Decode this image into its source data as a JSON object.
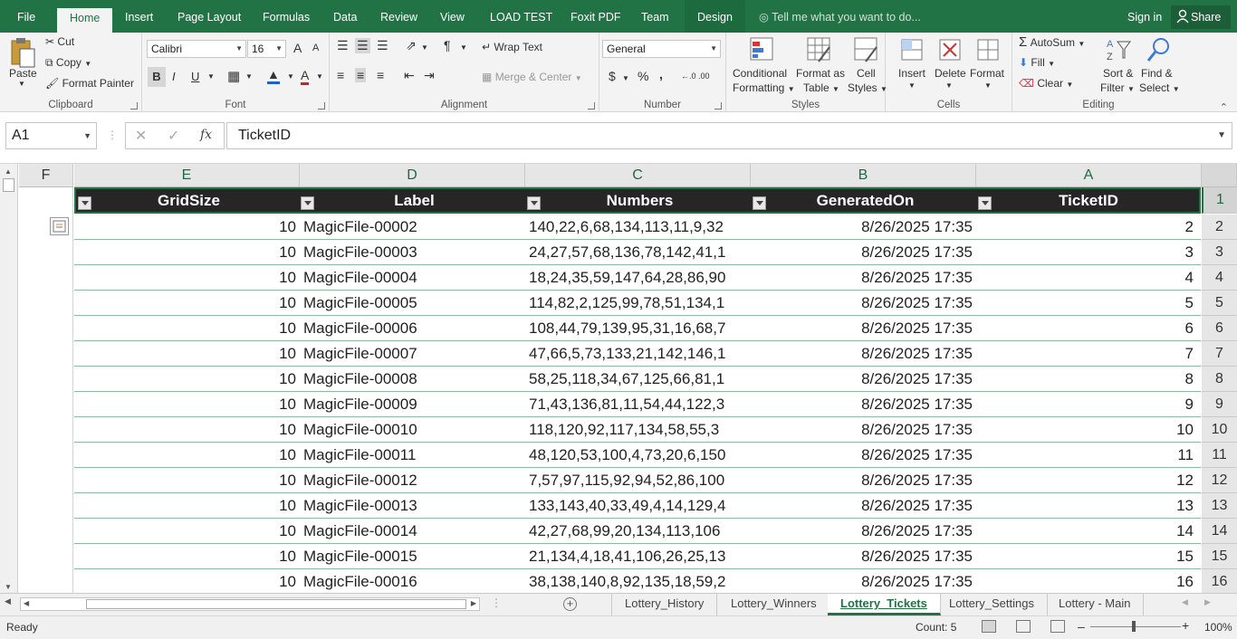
{
  "menu": {
    "tabs": [
      "File",
      "Home",
      "Insert",
      "Page Layout",
      "Formulas",
      "Data",
      "Review",
      "View",
      "LOAD TEST",
      "Foxit PDF",
      "Team",
      "Design"
    ],
    "active_tab": "Home",
    "tell_me": "Tell me what you want to do...",
    "sign_in": "Sign in",
    "share": "Share"
  },
  "ribbon": {
    "clipboard": {
      "label": "Clipboard",
      "paste": "Paste",
      "cut": "Cut",
      "copy": "Copy",
      "format_painter": "Format Painter"
    },
    "font": {
      "label": "Font",
      "family": "Calibri",
      "size": "16",
      "bold": "B",
      "italic": "I",
      "underline": "U",
      "grow": "A",
      "shrink": "A",
      "font_color": "A"
    },
    "alignment": {
      "label": "Alignment",
      "wrap_text": "Wrap Text",
      "merge_center": "Merge & Center"
    },
    "number": {
      "label": "Number",
      "format": "General",
      "currency": "$",
      "percent": "%",
      "comma": ",",
      "inc_decimal": "←.0 .00",
      "dec_decimal": ".00 →.0"
    },
    "styles": {
      "label": "Styles",
      "conditional_1": "Conditional",
      "conditional_2": "Formatting",
      "format_table_1": "Format as",
      "format_table_2": "Table",
      "cell_styles_1": "Cell",
      "cell_styles_2": "Styles"
    },
    "cells": {
      "label": "Cells",
      "insert": "Insert",
      "delete": "Delete",
      "format": "Format"
    },
    "editing": {
      "label": "Editing",
      "autosum": "AutoSum",
      "fill": "Fill",
      "clear": "Clear",
      "sort_1": "Sort &",
      "sort_2": "Filter",
      "find_1": "Find &",
      "find_2": "Select"
    }
  },
  "formula_bar": {
    "name_box": "A1",
    "fx": "fx",
    "content": "TicketID"
  },
  "columns": [
    {
      "letter": "F"
    },
    {
      "letter": "E",
      "header": "GridSize"
    },
    {
      "letter": "D",
      "header": "Label"
    },
    {
      "letter": "C",
      "header": "Numbers"
    },
    {
      "letter": "B",
      "header": "GeneratedOn"
    },
    {
      "letter": "A",
      "header": "TicketID"
    }
  ],
  "header_row_number": "1",
  "rows": [
    {
      "n": "2",
      "gridsize": "10",
      "label": "MagicFile-00002",
      "numbers": "140,22,6,68,134,113,11,9,32",
      "generated": "8/26/2025 17:35",
      "id": "2"
    },
    {
      "n": "3",
      "gridsize": "10",
      "label": "MagicFile-00003",
      "numbers": "24,27,57,68,136,78,142,41,1",
      "generated": "8/26/2025 17:35",
      "id": "3"
    },
    {
      "n": "4",
      "gridsize": "10",
      "label": "MagicFile-00004",
      "numbers": "18,24,35,59,147,64,28,86,90",
      "generated": "8/26/2025 17:35",
      "id": "4"
    },
    {
      "n": "5",
      "gridsize": "10",
      "label": "MagicFile-00005",
      "numbers": "114,82,2,125,99,78,51,134,1",
      "generated": "8/26/2025 17:35",
      "id": "5"
    },
    {
      "n": "6",
      "gridsize": "10",
      "label": "MagicFile-00006",
      "numbers": "108,44,79,139,95,31,16,68,7",
      "generated": "8/26/2025 17:35",
      "id": "6"
    },
    {
      "n": "7",
      "gridsize": "10",
      "label": "MagicFile-00007",
      "numbers": "47,66,5,73,133,21,142,146,1",
      "generated": "8/26/2025 17:35",
      "id": "7"
    },
    {
      "n": "8",
      "gridsize": "10",
      "label": "MagicFile-00008",
      "numbers": "58,25,118,34,67,125,66,81,1",
      "generated": "8/26/2025 17:35",
      "id": "8"
    },
    {
      "n": "9",
      "gridsize": "10",
      "label": "MagicFile-00009",
      "numbers": "71,43,136,81,11,54,44,122,3",
      "generated": "8/26/2025 17:35",
      "id": "9"
    },
    {
      "n": "10",
      "gridsize": "10",
      "label": "MagicFile-00010",
      "numbers": "118,120,92,117,134,58,55,3",
      "generated": "8/26/2025 17:35",
      "id": "10"
    },
    {
      "n": "11",
      "gridsize": "10",
      "label": "MagicFile-00011",
      "numbers": "48,120,53,100,4,73,20,6,150",
      "generated": "8/26/2025 17:35",
      "id": "11"
    },
    {
      "n": "12",
      "gridsize": "10",
      "label": "MagicFile-00012",
      "numbers": "7,57,97,115,92,94,52,86,100",
      "generated": "8/26/2025 17:35",
      "id": "12"
    },
    {
      "n": "13",
      "gridsize": "10",
      "label": "MagicFile-00013",
      "numbers": "133,143,40,33,49,4,14,129,4",
      "generated": "8/26/2025 17:35",
      "id": "13"
    },
    {
      "n": "14",
      "gridsize": "10",
      "label": "MagicFile-00014",
      "numbers": "42,27,68,99,20,134,113,106",
      "generated": "8/26/2025 17:35",
      "id": "14"
    },
    {
      "n": "15",
      "gridsize": "10",
      "label": "MagicFile-00015",
      "numbers": "21,134,4,18,41,106,26,25,13",
      "generated": "8/26/2025 17:35",
      "id": "15"
    },
    {
      "n": "16",
      "gridsize": "10",
      "label": "MagicFile-00016",
      "numbers": "38,138,140,8,92,135,18,59,2",
      "generated": "8/26/2025 17:35",
      "id": "16"
    }
  ],
  "sheets": [
    "Lottery_History",
    "Lottery_Winners",
    "Lottery_Tickets",
    "Lottery_Settings",
    "Lottery - Main"
  ],
  "active_sheet": "Lottery_Tickets",
  "status": {
    "ready": "Ready",
    "count": "Count: 5",
    "zoom": "100%"
  },
  "colors": {
    "excel_green": "#217346",
    "header_fill": "#262626"
  }
}
